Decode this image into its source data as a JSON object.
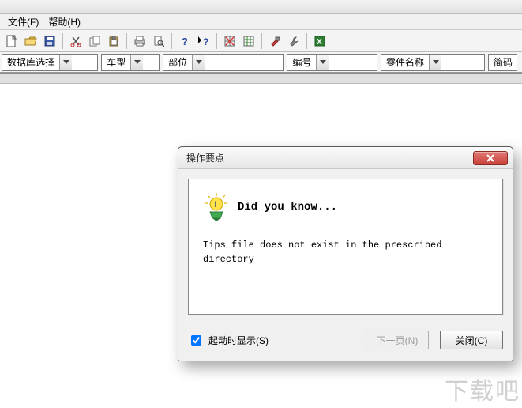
{
  "window": {
    "title_fragment": ""
  },
  "menu": {
    "file": "文件(F)",
    "help": "帮助(H)"
  },
  "toolbar_icons": {
    "new": "new-file-icon",
    "open": "open-folder-icon",
    "save": "save-icon",
    "cut": "cut-icon",
    "copy": "copy-icon",
    "paste": "paste-icon",
    "print": "print-icon",
    "print_preview": "print-preview-icon",
    "help": "help-icon",
    "whats_this": "whats-this-icon",
    "grid1": "grid-red-icon",
    "grid2": "grid-green-icon",
    "tool1": "hammer-icon",
    "tool2": "wrench-icon",
    "excel": "excel-icon"
  },
  "filters": {
    "db": "数据库选择",
    "model": "车型",
    "part": "部位",
    "code": "编号",
    "partname": "零件名称",
    "shortcode": "简码"
  },
  "dialog": {
    "title": "操作要点",
    "heading": "Did you know...",
    "message": "Tips file does not exist in the prescribed directory",
    "show_on_start": "起动时显示(S)",
    "show_on_start_checked": true,
    "next": "下一页(N)",
    "close": "关闭(C)"
  },
  "watermark": "下载吧"
}
